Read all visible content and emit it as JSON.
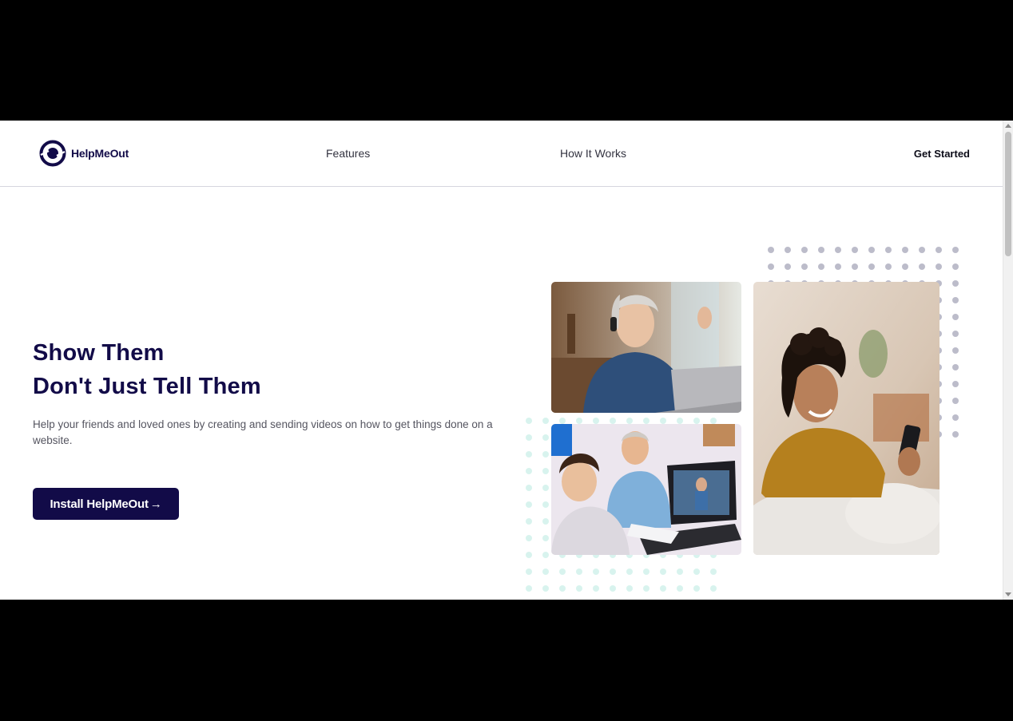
{
  "brand": {
    "name": "HelpMeOut",
    "color": "#120b48"
  },
  "nav": {
    "features_label": "Features",
    "how_label": "How It Works",
    "get_started_label": "Get Started"
  },
  "hero": {
    "title_line1": "Show Them",
    "title_line2": "Don't Just Tell Them",
    "description": "Help your friends and loved ones by creating and sending videos on how to get things done on a website.",
    "install_label": "Install HelpMeOut",
    "install_icon": "arrow-right-icon"
  },
  "images": [
    {
      "name": "woman-with-headphones-at-laptop-photo"
    },
    {
      "name": "grandfather-and-boy-at-laptop-photo"
    },
    {
      "name": "smiling-woman-with-phone-photo"
    }
  ],
  "colors": {
    "dots_purple": "#bcbcca",
    "dots_mint": "#d8f3ee"
  }
}
